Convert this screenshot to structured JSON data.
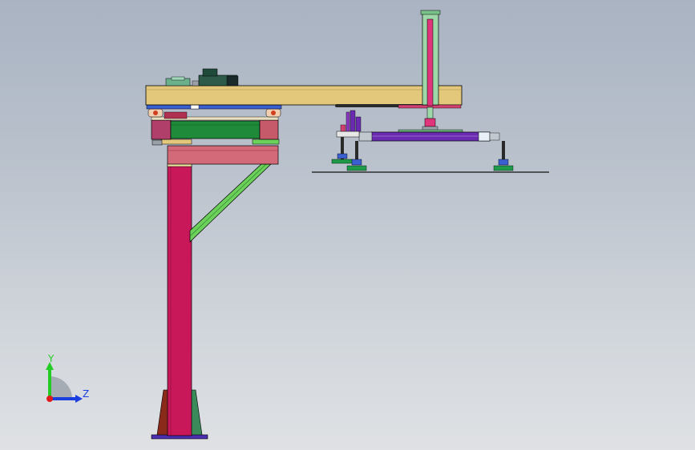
{
  "view": {
    "background_top": "#a9b3c2",
    "background_bottom": "#dfe1e4"
  },
  "model": {
    "description_icons": [
      "gantry-robot-model"
    ],
    "colors": {
      "beam": "#e3c77a",
      "column": "#c8185a",
      "brace": "#6bd15a",
      "carriage": "#1f8a3a",
      "carriage_end": "#c65a6a",
      "bracket": "#d26a7a",
      "rail_blue": "#3a5fd0",
      "vertical_axis": "#9ed8a8",
      "vertical_rod": "#e0357a",
      "gripper_bar": "#6a2bb0",
      "base_plate": "#4b2fb0",
      "suction_cup": "#1f9a4a",
      "motor": "#2e5a4a"
    }
  },
  "triad": {
    "y_label": "Y",
    "z_label": "Z",
    "y_color": "#22cc22",
    "z_color": "#1a3ee0",
    "x_color": "#e01a1a"
  }
}
